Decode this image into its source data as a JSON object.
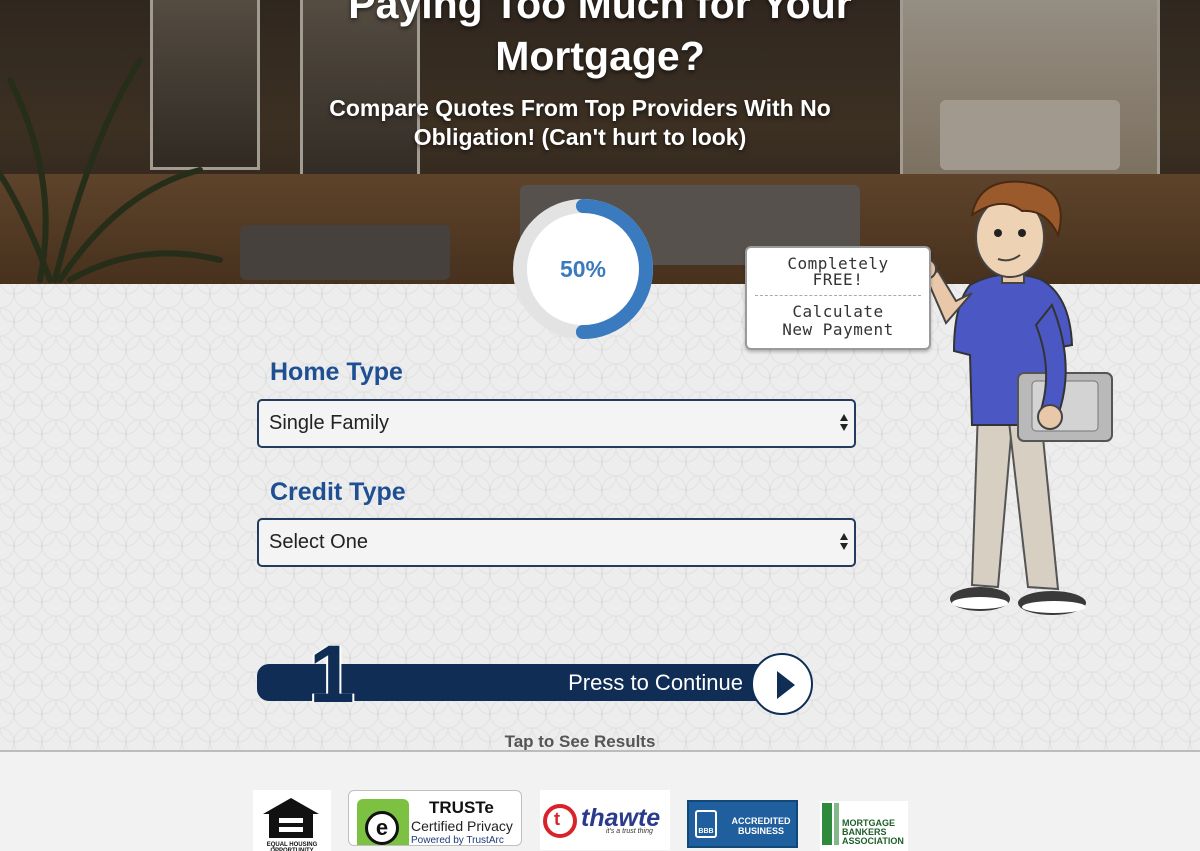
{
  "hero": {
    "title_line1": "Paying Too Much for Your",
    "title_line2": "Mortgage?",
    "subtitle": "Compare Quotes From Top Providers With No Obligation! (Can't hurt to look)"
  },
  "progress": {
    "percent": 50,
    "label": "50%",
    "accent": "#3a7bbf",
    "track": "#e3e3e3"
  },
  "form": {
    "home_type": {
      "label": "Home Type",
      "value": "Single Family"
    },
    "credit_type": {
      "label": "Credit Type",
      "value": "Select One"
    }
  },
  "continue": {
    "step": "1",
    "label": "Press to Continue"
  },
  "tap_text": "Tap to See Results",
  "bubble": {
    "line1": "Completely",
    "line2": "FREE!",
    "line3": "Calculate",
    "line4": "New Payment"
  },
  "badges": {
    "eho_caption": "EQUAL HOUSING OPPORTUNITY",
    "truste": {
      "title": "TRUSTe",
      "line2": "Certified Privacy",
      "line3": "Powered by TrustArc"
    },
    "thawte": {
      "name": "thawte",
      "tagline": "it's a trust thing"
    },
    "bbb": {
      "mark": "BBB",
      "text": "ACCREDITED BUSINESS"
    },
    "mba": {
      "text": "MORTGAGE BANKERS ASSOCIATION"
    }
  },
  "colors": {
    "navy": "#0f2d55",
    "label_blue": "#1e4f93"
  }
}
